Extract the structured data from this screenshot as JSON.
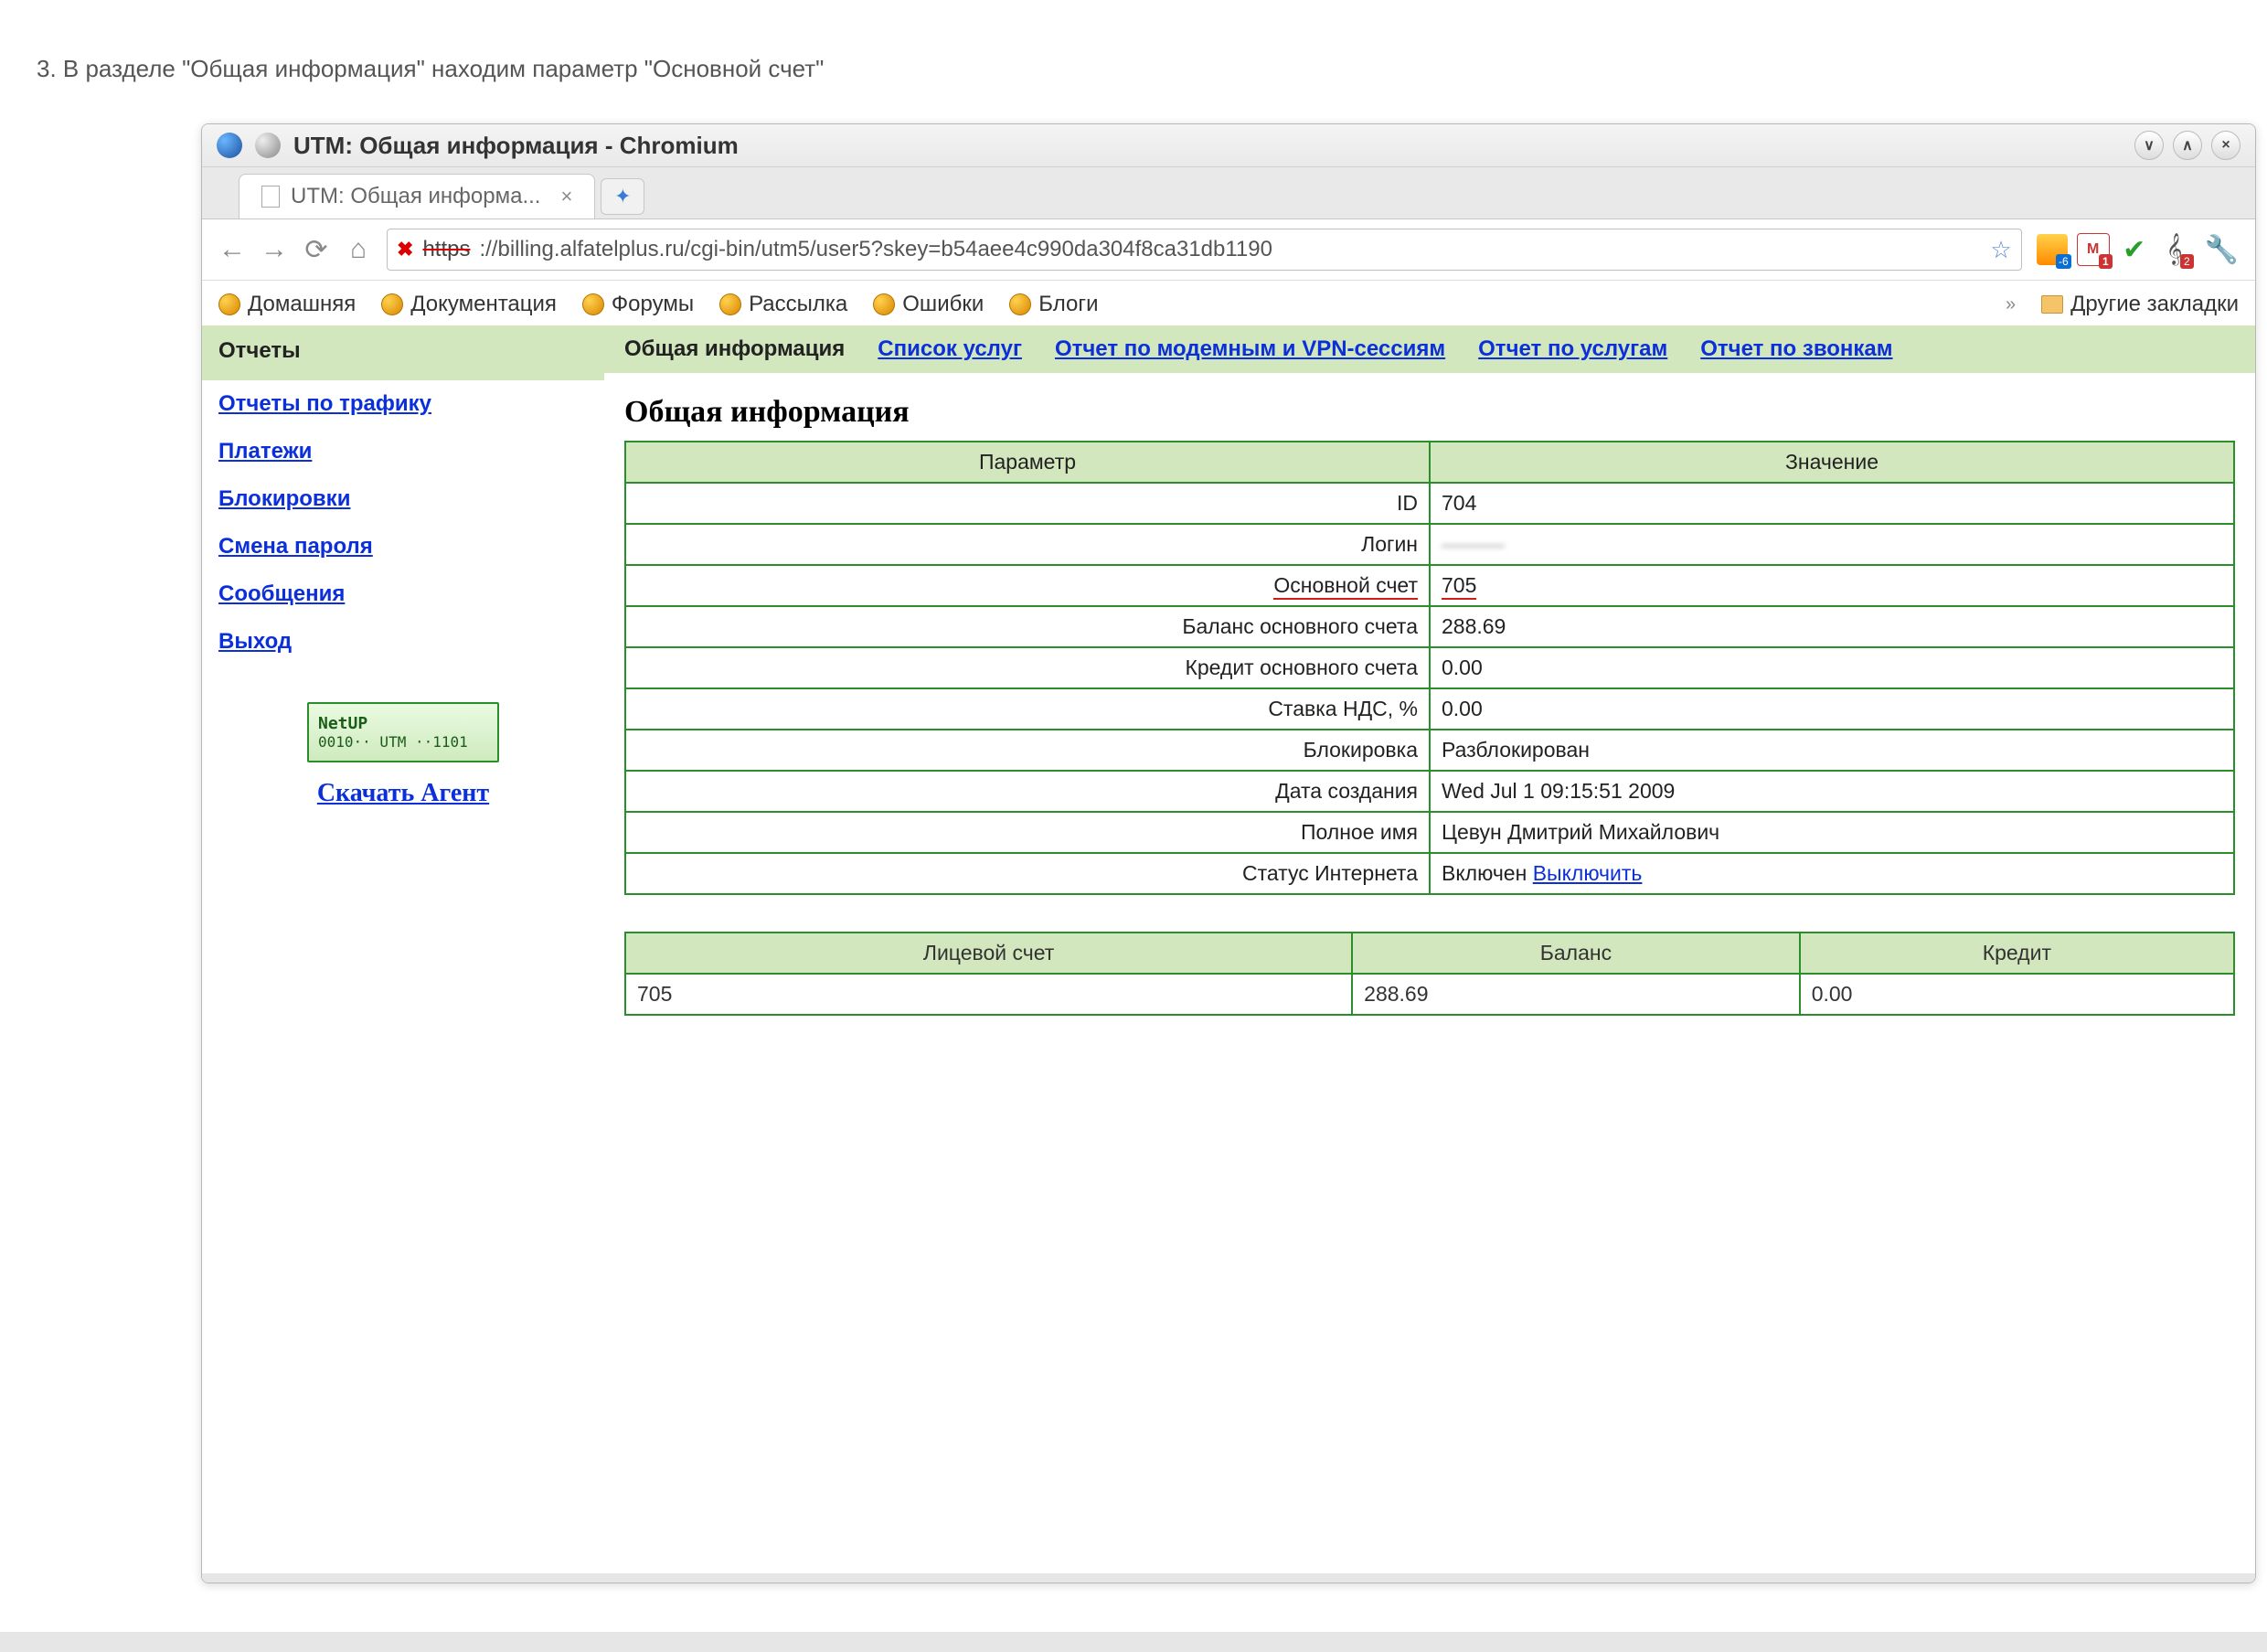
{
  "instruction": "3. В разделе \"Общая информация\" находим параметр \"Основной счет\"",
  "window": {
    "title": "UTM: Общая информация - Chromium"
  },
  "tab": {
    "title": "UTM: Общая информа..."
  },
  "url": {
    "scheme": "https",
    "rest": "://billing.alfatelplus.ru/cgi-bin/utm5/user5?skey=b54aee4c990da304f8ca31db1190"
  },
  "bookmarks": {
    "items": [
      "Домашняя",
      "Документация",
      "Форумы",
      "Рассылка",
      "Ошибки",
      "Блоги"
    ],
    "more": "»",
    "other": "Другие закладки"
  },
  "sidebar": {
    "header": "Отчеты",
    "items": [
      "Отчеты по трафику",
      "Платежи",
      "Блокировки",
      "Смена пароля",
      "Сообщения",
      "Выход"
    ],
    "netup": {
      "l1": "NetUP",
      "l2": "0010·· UTM ··1101"
    },
    "download": "Скачать Агент"
  },
  "subtabs": {
    "active": "Общая информация",
    "others": [
      "Список услуг",
      "Отчет по модемным и VPN-сессиям",
      "Отчет по услугам",
      "Отчет по звонкам"
    ]
  },
  "page_title": "Общая информация",
  "info_table": {
    "headers": [
      "Параметр",
      "Значение"
    ],
    "rows": [
      {
        "param": "ID",
        "value": "704",
        "hl": false
      },
      {
        "param": "Логин",
        "value": "———",
        "hl": false,
        "blur": true
      },
      {
        "param": "Основной счет",
        "value": "705",
        "hl": true
      },
      {
        "param": "Баланс основного счета",
        "value": "288.69",
        "hl": false
      },
      {
        "param": "Кредит основного счета",
        "value": "0.00",
        "hl": false
      },
      {
        "param": "Ставка НДС, %",
        "value": "0.00",
        "hl": false
      },
      {
        "param": "Блокировка",
        "value": "Разблокирован",
        "hl": false
      },
      {
        "param": "Дата создания",
        "value": "Wed Jul 1 09:15:51 2009",
        "hl": false
      },
      {
        "param": "Полное имя",
        "value": "Цевун Дмитрий Михайлович",
        "hl": false
      },
      {
        "param": "Статус Интернета",
        "value": "Включен",
        "hl": false,
        "link": "Выключить"
      }
    ]
  },
  "acct_table": {
    "headers": [
      "Лицевой счет",
      "Баланс",
      "Кредит"
    ],
    "row": [
      "705",
      "288.69",
      "0.00"
    ]
  }
}
